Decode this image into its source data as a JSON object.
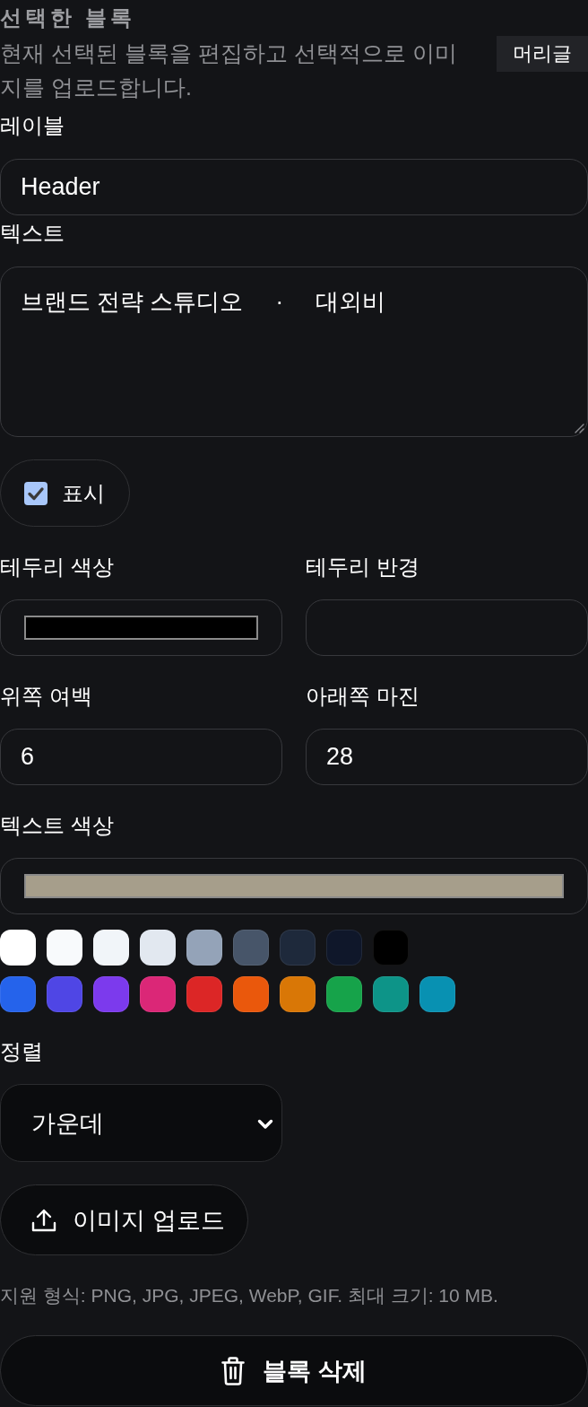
{
  "panel": {
    "title": "선택한 블록",
    "description": "현재 선택된 블록을 편집하고 선택적으로 이미지를 업로드합니다.",
    "badge": "머리글"
  },
  "label_field": {
    "label": "레이블",
    "value": "Header"
  },
  "text_field": {
    "label": "텍스트",
    "value": "브랜드 전략 스튜디오     ·     대외비"
  },
  "visible_toggle": {
    "label": "표시",
    "checked": true
  },
  "style_fields": [
    {
      "kind": "color",
      "label": "테두리 색상",
      "color": "#000000"
    },
    {
      "kind": "number",
      "label": "테두리 반경"
    },
    {
      "kind": "number",
      "label": "위쪽 여백",
      "value": "6"
    },
    {
      "kind": "number",
      "label": "아래쪽 마진",
      "value": "28"
    }
  ],
  "text_color": {
    "label": "텍스트 색상",
    "color": "#a69e8b"
  },
  "palette": [
    {
      "swatches": [
        {
          "color": "#ffffff"
        },
        {
          "color": "#f8fafc"
        },
        {
          "color": "#f1f5f9"
        },
        {
          "color": "#e2e8f0"
        },
        {
          "color": "#94a3b8"
        },
        {
          "color": "#475569"
        },
        {
          "color": "#1e293b"
        },
        {
          "color": "#0f172a"
        },
        {
          "color": "#000000"
        }
      ]
    },
    {
      "swatches": [
        {
          "color": "#2563eb"
        },
        {
          "color": "#4f46e5"
        },
        {
          "color": "#7c3aed"
        },
        {
          "color": "#db2777"
        },
        {
          "color": "#dc2626"
        },
        {
          "color": "#ea580c"
        },
        {
          "color": "#d97706"
        },
        {
          "color": "#16a34a"
        },
        {
          "color": "#0d9488"
        },
        {
          "color": "#0891b2"
        }
      ]
    }
  ],
  "alignment": {
    "label": "정렬",
    "value": "가운데"
  },
  "upload_button": {
    "label": "이미지 업로드"
  },
  "help_text": "지원 형식: PNG, JPG, JPEG, WebP, GIF. 최대 크기: 10 MB.",
  "delete_button": {
    "label": "블록 삭제"
  }
}
